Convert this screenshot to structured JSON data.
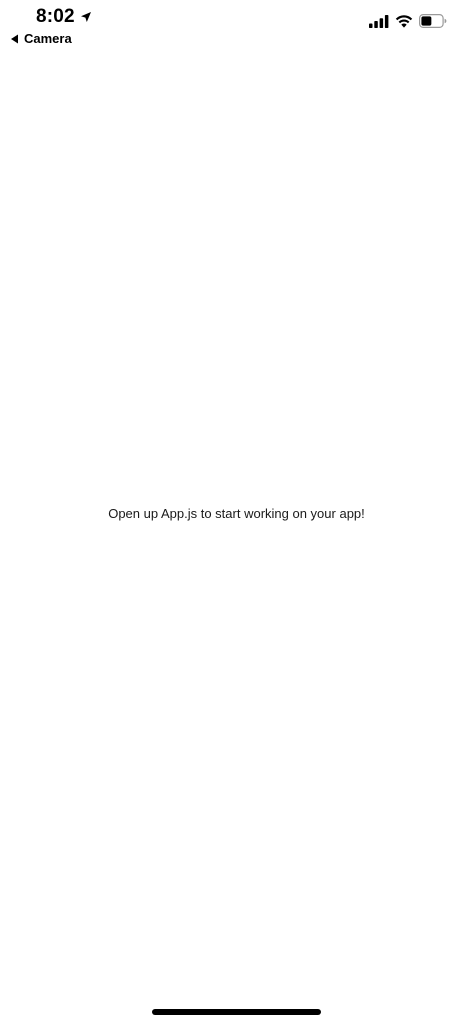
{
  "status_bar": {
    "time": "8:02",
    "location_icon": "location-arrow-icon",
    "back_app_label": "Camera",
    "back_icon": "back-caret-icon",
    "signal_icon": "cellular-signal-icon",
    "wifi_icon": "wifi-icon",
    "battery_icon": "battery-icon",
    "battery_level": 0.5
  },
  "main": {
    "message": "Open up App.js to start working on your app!"
  },
  "colors": {
    "background": "#ffffff",
    "text": "#000000"
  }
}
